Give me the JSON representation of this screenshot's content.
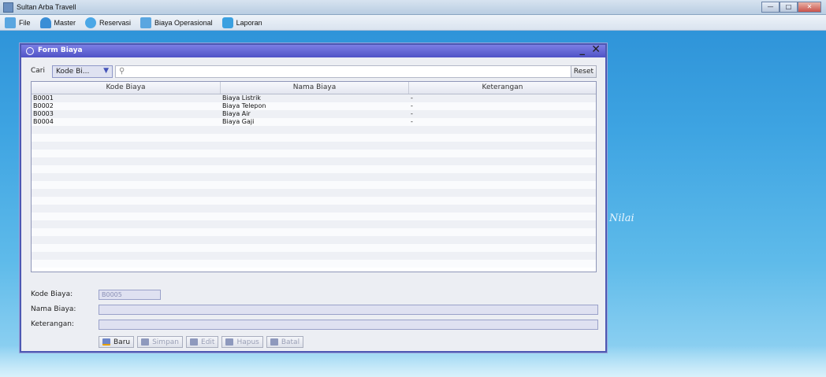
{
  "window": {
    "title": "Sultan Arba Travell"
  },
  "menubar": [
    {
      "label": "File",
      "icon": "file-icon"
    },
    {
      "label": "Master",
      "icon": "people-icon"
    },
    {
      "label": "Reservasi",
      "icon": "reservation-icon"
    },
    {
      "label": "Biaya Operasional",
      "icon": "document-icon"
    },
    {
      "label": "Laporan",
      "icon": "report-icon"
    }
  ],
  "background": {
    "watermark": "Nilai"
  },
  "form": {
    "title": "Form Biaya",
    "search": {
      "label": "Cari",
      "selected": "Kode Bi...",
      "value": "",
      "reset_label": "Reset"
    },
    "table": {
      "headers": [
        "Kode Biaya",
        "Nama Biaya",
        "Keterangan"
      ],
      "rows": [
        [
          "B0001",
          "Biaya Listrik",
          "-"
        ],
        [
          "B0002",
          "Biaya Telepon",
          "-"
        ],
        [
          "B0003",
          "Biaya Air",
          "-"
        ],
        [
          "B0004",
          "Biaya Gaji",
          "-"
        ]
      ],
      "empty_rows": 18
    },
    "fields": {
      "kode_label": "Kode Biaya:",
      "kode_value": "B0005",
      "nama_label": "Nama Biaya:",
      "nama_value": "",
      "keterangan_label": "Keterangan:",
      "keterangan_value": ""
    },
    "buttons": {
      "baru": "Baru",
      "simpan": "Simpan",
      "edit": "Edit",
      "hapus": "Hapus",
      "batal": "Batal"
    }
  },
  "colors": {
    "frame_title": "#4f52c6",
    "desktop": "#3ea4e2",
    "field_bg": "#dfe1f1"
  }
}
